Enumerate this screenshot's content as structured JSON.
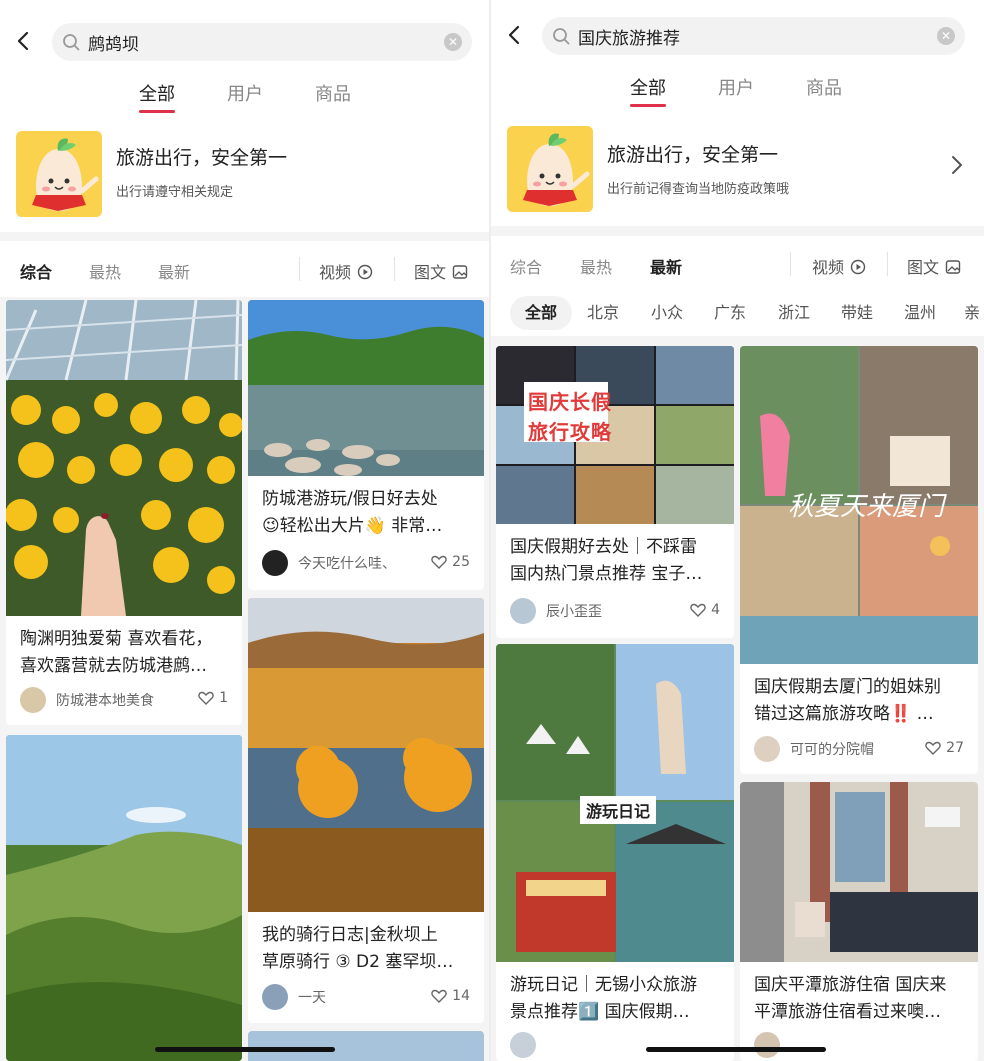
{
  "left": {
    "search": {
      "query": "鹧鸪坝"
    },
    "tabs": [
      "全部",
      "用户",
      "商品"
    ],
    "card": {
      "title": "旅游出行，安全第一",
      "subtitle": "出行请遵守相关规定"
    },
    "filters": {
      "all": "综合",
      "hot": "最热",
      "new": "最新",
      "video": "视频",
      "note": "图文"
    },
    "posts": [
      {
        "title": "陶渊明独爱菊 喜欢看花，\n喜欢露营就去防城港鹧…",
        "author": "防城港本地美食",
        "likes": "1"
      },
      {
        "title": "防城港游玩/假日好去处\n😉轻松出大片👋 非常…",
        "author": "今天吃什么哇、",
        "likes": "25"
      },
      {
        "title": "我的骑行日志|金秋坝上\n草原骑行 ③ D2 塞罕坝…",
        "author": "一天",
        "likes": "14"
      }
    ]
  },
  "right": {
    "search": {
      "query": "国庆旅游推荐"
    },
    "tabs": [
      "全部",
      "用户",
      "商品"
    ],
    "card": {
      "title": "旅游出行，安全第一",
      "subtitle": "出行前记得查询当地防疫政策哦"
    },
    "filters": {
      "all": "综合",
      "hot": "最热",
      "new": "最新",
      "video": "视频",
      "note": "图文"
    },
    "chips": [
      "全部",
      "北京",
      "小众",
      "广东",
      "浙江",
      "带娃",
      "温州",
      "亲"
    ],
    "posts": [
      {
        "title": "国庆假期好去处｜不踩雷\n国内热门景点推荐 宝子…",
        "author": "辰小歪歪",
        "likes": "4",
        "overlay": [
          "国庆长假",
          "旅行攻略"
        ]
      },
      {
        "title": "国庆假期去厦门的姐妹别\n错过这篇旅游攻略‼️ …",
        "author": "可可的分院帽",
        "likes": "27",
        "overlay": [
          "秋夏天来厦门"
        ]
      },
      {
        "title": "游玩日记｜无锡小众旅游\n景点推荐1️⃣ 国庆假期…",
        "overlay": [
          "游玩日记"
        ]
      },
      {
        "title": "国庆平潭旅游住宿 国庆来\n平潭旅游住宿看过来噢…"
      }
    ]
  },
  "colors": {
    "accent": "#e0304a",
    "tag_red": "#e03a3a"
  }
}
